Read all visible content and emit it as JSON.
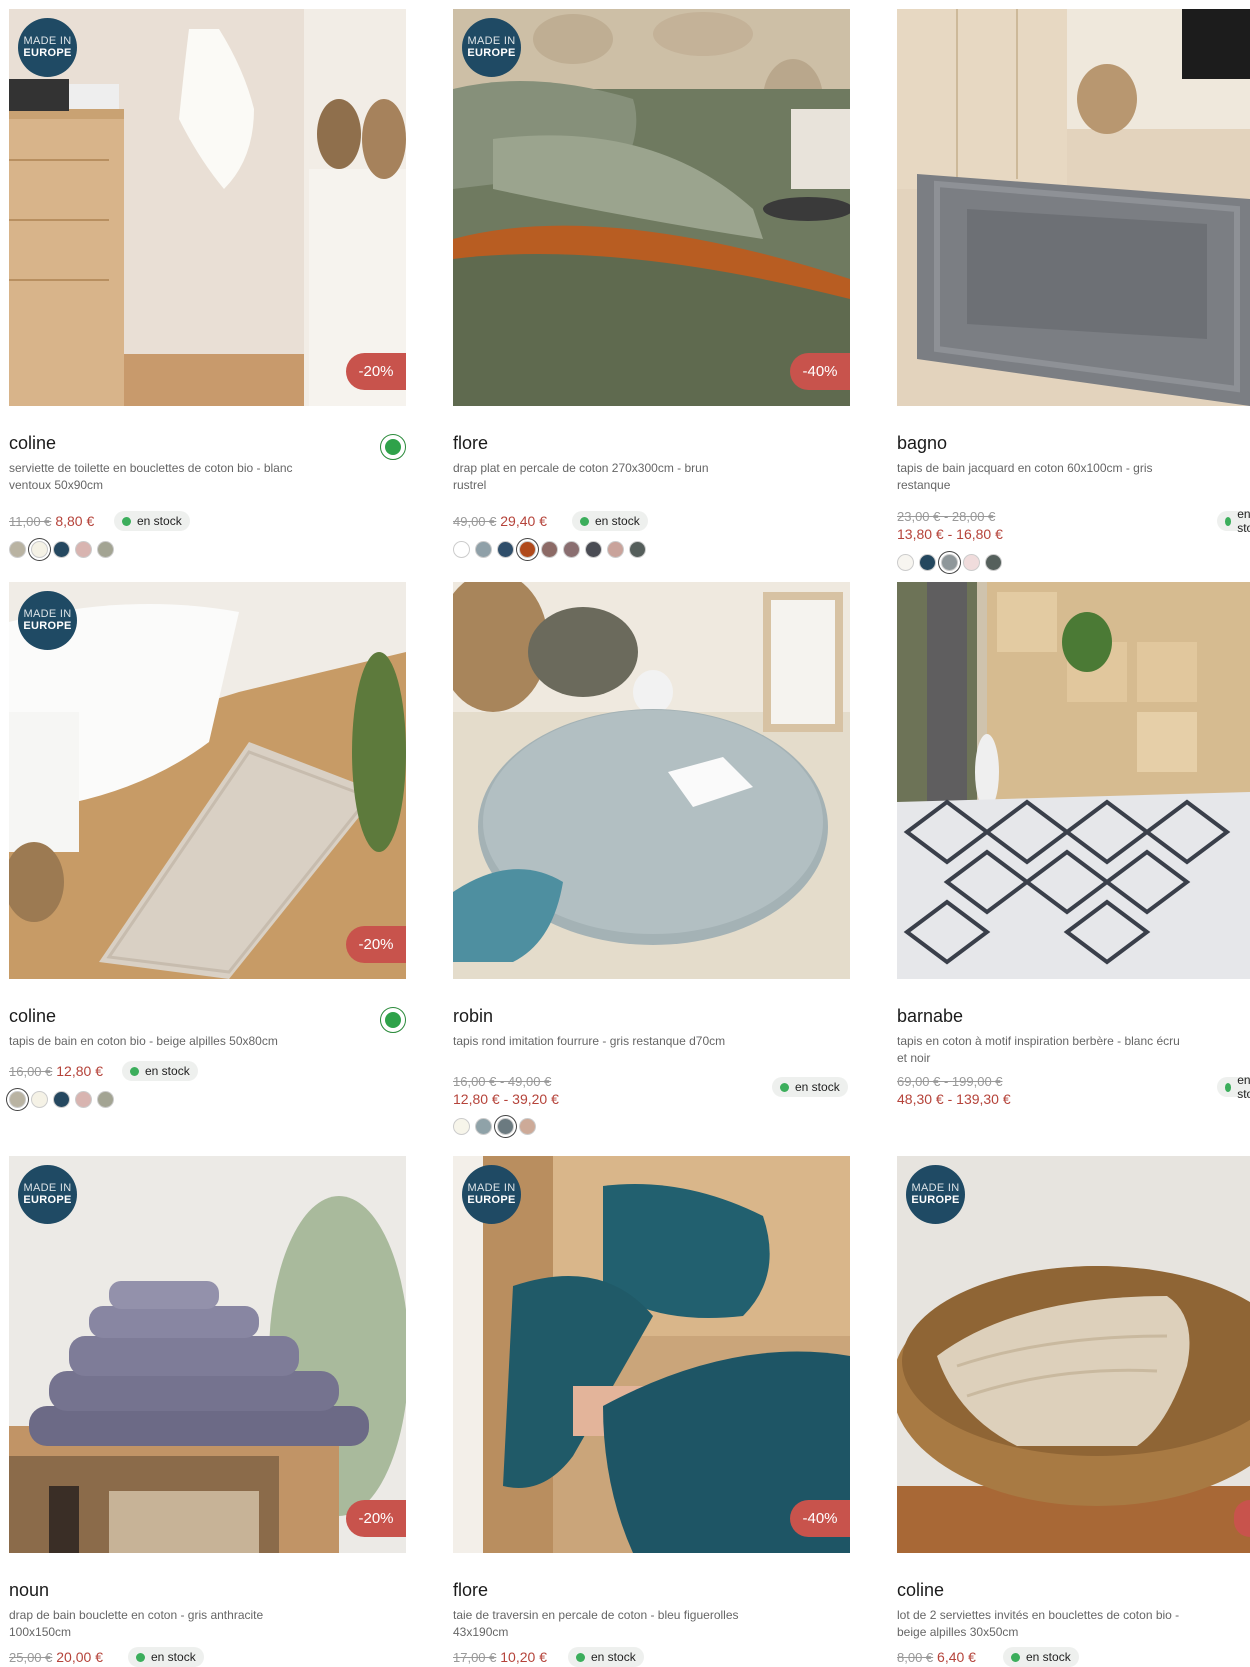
{
  "products": [
    {
      "name": "coline",
      "desc": "serviette de toilette en bouclettes de coton bio - blanc ventoux 50x90cm",
      "old": "11,00 €",
      "new": "8,80 €",
      "stock": "en stock",
      "badge_top": "MADE IN",
      "badge_bottom": "EUROPE",
      "discount": "-20%",
      "swatches": [
        "#b9b3a2",
        "#f5f2e6",
        "#254860",
        "#d8b4b0",
        "#a3a493"
      ],
      "selected": 1
    },
    {
      "name": "flore",
      "desc": "drap plat en percale de coton 270x300cm - brun rustrel",
      "old": "49,00 €",
      "new": "29,40 €",
      "stock": "en stock",
      "badge_top": "MADE IN",
      "badge_bottom": "EUROPE",
      "discount": "-40%",
      "swatches": [
        "#ffffff",
        "#8fa0a8",
        "#2f4e6a",
        "#b04a1c",
        "#8c6a66",
        "#8a6e70",
        "#4a4c54",
        "#c9a39b",
        "#555e5b"
      ],
      "selected": 3
    },
    {
      "name": "bagno",
      "desc": "tapis de bain jacquard en coton 60x100cm - gris restanque",
      "old": "23,00 € - 28,00 €",
      "new": "13,80 € - 16,80 €",
      "stock": "en stock",
      "swatches": [
        "#f7f5f0",
        "#23475e",
        "#8f979a",
        "#f0dcdc",
        "#55605c"
      ],
      "selected": 2
    },
    {
      "name": "coline",
      "desc": "tapis de bain en coton bio - beige alpilles 50x80cm",
      "old": "16,00 €",
      "new": "12,80 €",
      "stock": "en stock",
      "badge_top": "MADE IN",
      "badge_bottom": "EUROPE",
      "discount": "-20%",
      "swatches": [
        "#b9b3a2",
        "#f5f2e6",
        "#254860",
        "#d8b4b0",
        "#a3a493"
      ],
      "selected": 0
    },
    {
      "name": "robin",
      "desc": "tapis rond imitation fourrure - gris restanque d70cm",
      "old": "16,00 € - 49,00 €",
      "new": "12,80 € - 39,20 €",
      "stock": "en stock",
      "swatches": [
        "#f7f5ea",
        "#8fa2a8",
        "#6b7a80",
        "#cdaa98"
      ],
      "selected": 2
    },
    {
      "name": "barnabe",
      "desc": "tapis en coton à motif inspiration berbère - blanc écru et noir",
      "old": "69,00 € - 199,00 €",
      "new": "48,30 € - 139,30 €",
      "stock": "en stock",
      "swatches": [],
      "selected": -1
    },
    {
      "name": "noun",
      "desc": "drap de bain bouclette en coton - gris anthracite 100x150cm",
      "old": "25,00 €",
      "new": "20,00 €",
      "stock": "en stock",
      "badge_top": "MADE IN",
      "badge_bottom": "EUROPE",
      "discount": "-20%",
      "swatches": [],
      "selected": -1
    },
    {
      "name": "flore",
      "desc": "taie de traversin en percale de coton - bleu figuerolles 43x190cm",
      "old": "17,00 €",
      "new": "10,20 €",
      "stock": "en stock",
      "badge_top": "MADE IN",
      "badge_bottom": "EUROPE",
      "discount": "-40%",
      "swatches": [],
      "selected": -1
    },
    {
      "name": "coline",
      "desc": "lot de 2 serviettes invités en bouclettes de coton bio - beige alpilles 30x50cm",
      "old": "8,00 €",
      "new": "6,40 €",
      "stock": "en stock",
      "badge_top": "MADE IN",
      "badge_bottom": "EUROPE",
      "swatches": [],
      "selected": -1
    }
  ]
}
